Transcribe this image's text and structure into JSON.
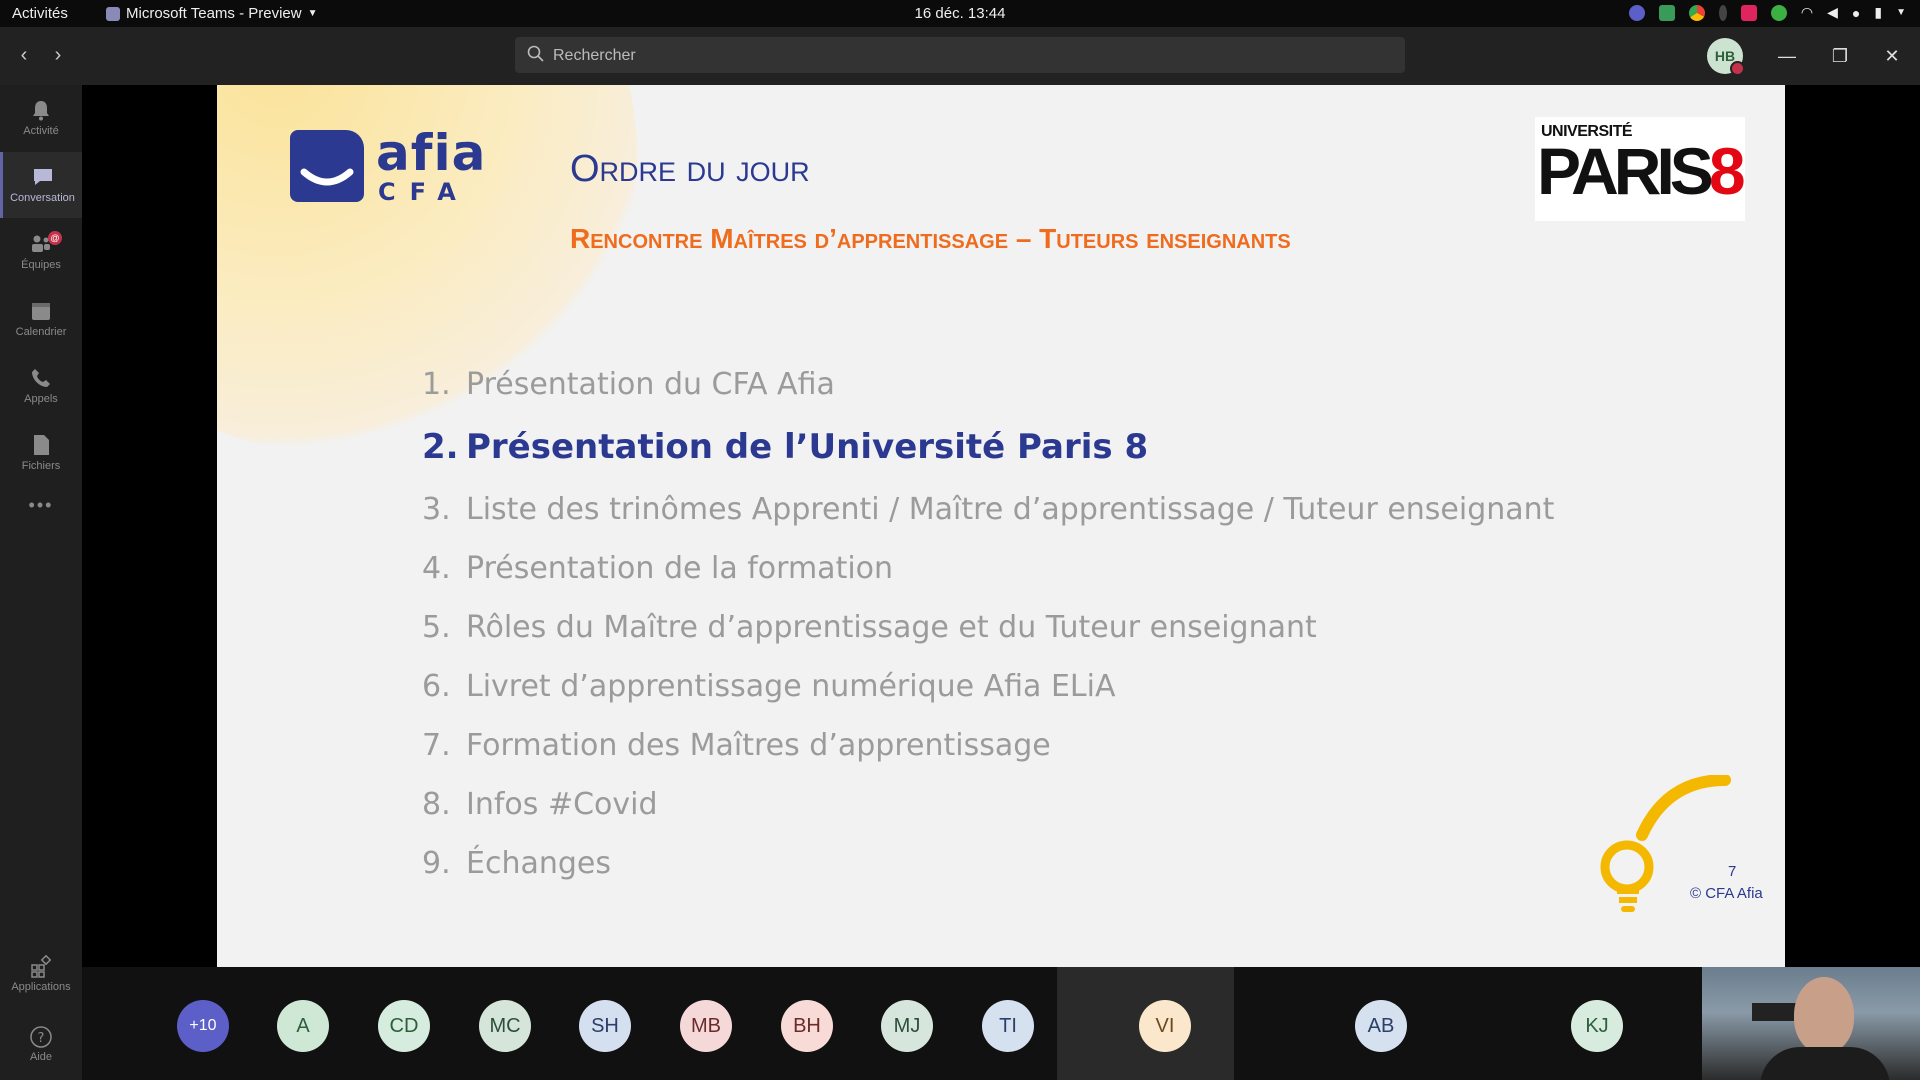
{
  "topbar": {
    "activities": "Activités",
    "app_name": "Microsoft Teams - Preview",
    "clock": "16 déc.  13:44"
  },
  "titlebar": {
    "search_placeholder": "Rechercher",
    "avatar_initials": "HB"
  },
  "rail": {
    "items": [
      {
        "label": "Activité",
        "icon": "bell-icon"
      },
      {
        "label": "Conversation",
        "icon": "chat-icon"
      },
      {
        "label": "Équipes",
        "icon": "teams-icon"
      },
      {
        "label": "Calendrier",
        "icon": "calendar-icon"
      },
      {
        "label": "Appels",
        "icon": "phone-icon"
      },
      {
        "label": "Fichiers",
        "icon": "file-icon"
      }
    ],
    "more": "•••",
    "apps": "Applications",
    "help": "Aide"
  },
  "slide": {
    "logo_word": "afia",
    "logo_sub": "CFA",
    "partner_logo_top": "UNIVERSITÉ",
    "partner_logo_main": "PARIS",
    "partner_logo_num": "8",
    "title": "Ordre du jour",
    "subtitle": "Rencontre Maîtres d’apprentissage – Tuteurs enseignants",
    "agenda": [
      {
        "num": "1.",
        "text": "Présentation du CFA Afia"
      },
      {
        "num": "2.",
        "text": "Présentation de l’Université Paris 8"
      },
      {
        "num": "3.",
        "text": "Liste des trinômes Apprenti / Maître d’apprentissage / Tuteur enseignant"
      },
      {
        "num": "4.",
        "text": "Présentation de la formation"
      },
      {
        "num": "5.",
        "text": "Rôles du Maître d’apprentissage et du Tuteur enseignant"
      },
      {
        "num": "6.",
        "text": "Livret d’apprentissage numérique Afia ELiA"
      },
      {
        "num": "7.",
        "text": "Formation des Maîtres d’apprentissage"
      },
      {
        "num": "8.",
        "text": "Infos #Covid"
      },
      {
        "num": "9.",
        "text": "Échanges"
      }
    ],
    "active_index": 1,
    "page_number": "7",
    "copyright": "© CFA Afia"
  },
  "participants": [
    {
      "initials": "+10",
      "color": "#5b5fc7",
      "text_color": "#ffffff"
    },
    {
      "initials": "A",
      "color": "#cfe8d6",
      "text_color": "#2d5f3a"
    },
    {
      "initials": "CD",
      "color": "#d6ecdf",
      "text_color": "#2d5f3a"
    },
    {
      "initials": "MC",
      "color": "#d5e5da",
      "text_color": "#2d4f3a"
    },
    {
      "initials": "SH",
      "color": "#d4dff0",
      "text_color": "#2b3f6a"
    },
    {
      "initials": "MB",
      "color": "#f5d9d9",
      "text_color": "#6a2b2b"
    },
    {
      "initials": "BH",
      "color": "#f8dbd6",
      "text_color": "#6a2b2b"
    },
    {
      "initials": "MJ",
      "color": "#d7e6dc",
      "text_color": "#2d4f3a"
    },
    {
      "initials": "TI",
      "color": "#d6e1f0",
      "text_color": "#2b3f6a"
    },
    {
      "initials": "VI",
      "color": "#fbe7cc",
      "text_color": "#6a4a1f"
    },
    {
      "initials": "AB",
      "color": "#d6e1f0",
      "text_color": "#2b3f6a"
    },
    {
      "initials": "KJ",
      "color": "#d7ecdf",
      "text_color": "#2d5f3a"
    }
  ]
}
